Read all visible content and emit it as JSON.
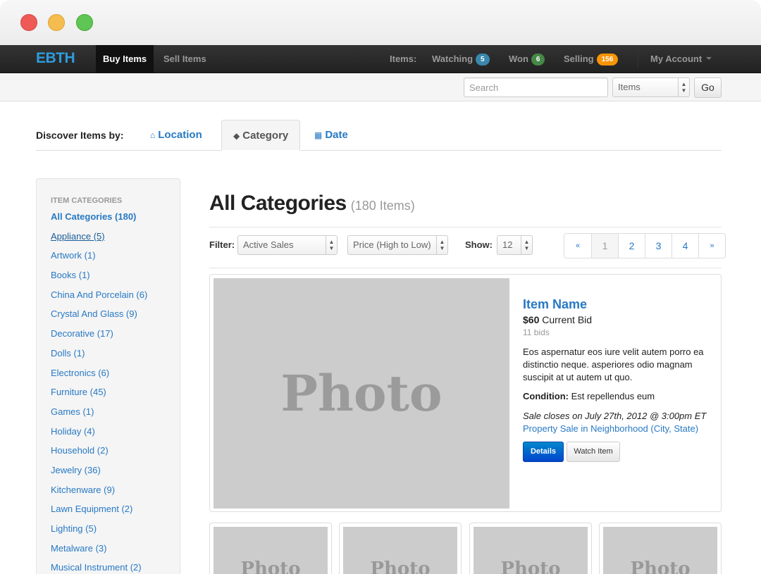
{
  "navbar": {
    "brand": "EBTH",
    "buy_items": "Buy Items",
    "sell_items": "Sell Items",
    "items_label": "Items:",
    "watching_label": "Watching",
    "watching_count": "5",
    "won_label": "Won",
    "won_count": "6",
    "selling_label": "Selling",
    "selling_count": "156",
    "account_label": "My Account"
  },
  "search": {
    "placeholder": "Search",
    "type_value": "Items",
    "go_label": "Go"
  },
  "discover": {
    "label": "Discover Items by:",
    "tabs": [
      {
        "label": "Location",
        "icon": "home-icon",
        "active": false
      },
      {
        "label": "Category",
        "icon": "tag-icon",
        "active": true
      },
      {
        "label": "Date",
        "icon": "calendar-icon",
        "active": false
      }
    ]
  },
  "sidebar": {
    "header": "Item Categories",
    "items": [
      "All Categories (180)",
      "Appliance (5)",
      "Artwork (1)",
      "Books (1)",
      "China And Porcelain (6)",
      "Crystal And Glass (9)",
      "Decorative (17)",
      "Dolls (1)",
      "Electronics (6)",
      "Furniture (45)",
      "Games (1)",
      "Holiday (4)",
      "Household (2)",
      "Jewelry (36)",
      "Kitchenware (9)",
      "Lawn Equipment (2)",
      "Lighting (5)",
      "Metalware (3)",
      "Musical Instrument (2)"
    ]
  },
  "main": {
    "title": "All Categories",
    "count": "(180 Items)",
    "filter_label": "Filter:",
    "filter_value": "Active Sales",
    "sort_value": "Price (High to Low)",
    "show_label": "Show:",
    "show_value": "12",
    "pagination": [
      "«",
      "1",
      "2",
      "3",
      "4",
      "»"
    ],
    "pagination_active": "1"
  },
  "featured": {
    "photo_text": "Photo",
    "name": "Item Name",
    "bid_amount": "$60",
    "bid_label": "Current Bid",
    "bids": "11 bids",
    "description": "Eos aspernatur eos iure velit autem porro ea distinctio neque. asperiores odio magnam suscipit at ut autem ut quo.",
    "condition_label": "Condition:",
    "condition_value": "Est repellendus eum",
    "closes": "Sale closes on July 27th, 2012 @ 3:00pm ET",
    "location": "Property Sale in Neighborhood (City, State)",
    "details_button": "Details",
    "watch_button": "Watch Item"
  },
  "thumbnails": [
    "Photo",
    "Photo",
    "Photo",
    "Photo"
  ],
  "colors": {
    "brand": "#2d9cde",
    "link": "#2779c4",
    "navbar": "#222222",
    "primary_button": "#0055cc",
    "badge_watching": "#3a87ad",
    "badge_won": "#468847",
    "badge_selling": "#f89406"
  }
}
